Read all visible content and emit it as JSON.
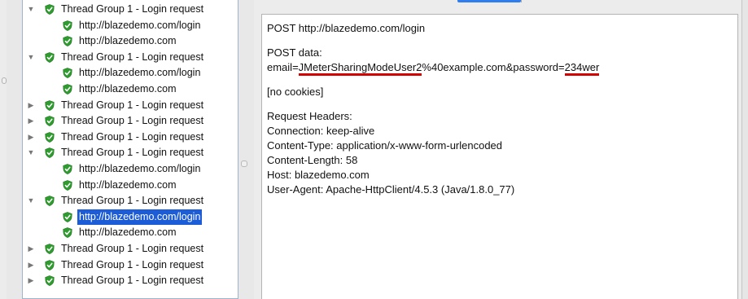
{
  "tree": {
    "items": [
      {
        "label": "Thread Group 1 - Login request",
        "arrow": "▼",
        "level": 0
      },
      {
        "label": "http://blazedemo.com/login",
        "level": 1
      },
      {
        "label": "http://blazedemo.com",
        "level": 1
      },
      {
        "label": "Thread Group 1 - Login request",
        "arrow": "▼",
        "level": 0
      },
      {
        "label": "http://blazedemo.com/login",
        "level": 1
      },
      {
        "label": "http://blazedemo.com",
        "level": 1
      },
      {
        "label": "Thread Group 1 - Login request",
        "arrow": "▶",
        "level": 0
      },
      {
        "label": "Thread Group 1 - Login request",
        "arrow": "▶",
        "level": 0
      },
      {
        "label": "Thread Group 1 - Login request",
        "arrow": "▶",
        "level": 0
      },
      {
        "label": "Thread Group 1 - Login request",
        "arrow": "▼",
        "level": 0
      },
      {
        "label": "http://blazedemo.com/login",
        "level": 1
      },
      {
        "label": "http://blazedemo.com",
        "level": 1
      },
      {
        "label": "Thread Group 1 - Login request",
        "arrow": "▼",
        "level": 0
      },
      {
        "label": "http://blazedemo.com/login",
        "level": 1,
        "selected": true
      },
      {
        "label": "http://blazedemo.com",
        "level": 1
      },
      {
        "label": "Thread Group 1 - Login request",
        "arrow": "▶",
        "level": 0
      },
      {
        "label": "Thread Group 1 - Login request",
        "arrow": "▶",
        "level": 0
      },
      {
        "label": "Thread Group 1 - Login request",
        "arrow": "▶",
        "level": 0
      }
    ]
  },
  "request": {
    "line1": "POST http://blazedemo.com/login",
    "post_data_label": "POST data:",
    "post_prefix": "email=",
    "post_user": "JMeterSharingModeUser2",
    "post_middle": "%40example.com&password=",
    "post_password": "234wer",
    "no_cookies": "[no cookies]",
    "headers_label": "Request Headers:",
    "h_connection": "Connection: keep-alive",
    "h_content_type": "Content-Type: application/x-www-form-urlencoded",
    "h_content_length": "Content-Length: 58",
    "h_host": "Host: blazedemo.com",
    "h_user_agent": "User-Agent: Apache-HttpClient/4.5.3 (Java/1.8.0_77)"
  },
  "colors": {
    "selection": "#1c5cd7",
    "underline": "#d40000",
    "shield_green": "#2e9c2e",
    "tab_active": "#2f7ef0"
  }
}
